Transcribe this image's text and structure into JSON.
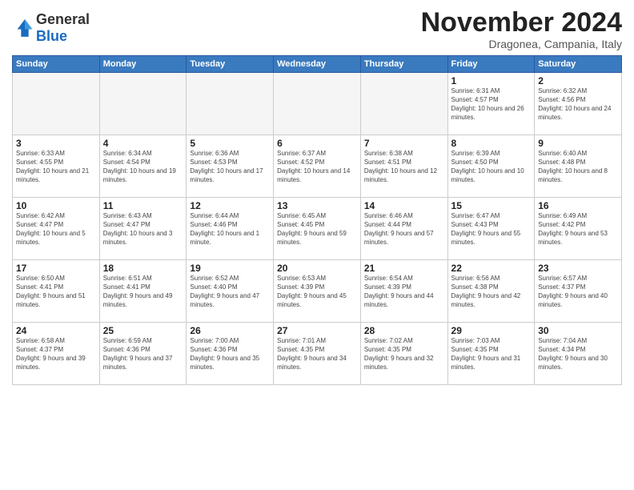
{
  "logo": {
    "text_general": "General",
    "text_blue": "Blue"
  },
  "title": "November 2024",
  "subtitle": "Dragonea, Campania, Italy",
  "days_header": [
    "Sunday",
    "Monday",
    "Tuesday",
    "Wednesday",
    "Thursday",
    "Friday",
    "Saturday"
  ],
  "weeks": [
    [
      {
        "day": "",
        "info": ""
      },
      {
        "day": "",
        "info": ""
      },
      {
        "day": "",
        "info": ""
      },
      {
        "day": "",
        "info": ""
      },
      {
        "day": "",
        "info": ""
      },
      {
        "day": "1",
        "info": "Sunrise: 6:31 AM\nSunset: 4:57 PM\nDaylight: 10 hours and 26 minutes."
      },
      {
        "day": "2",
        "info": "Sunrise: 6:32 AM\nSunset: 4:56 PM\nDaylight: 10 hours and 24 minutes."
      }
    ],
    [
      {
        "day": "3",
        "info": "Sunrise: 6:33 AM\nSunset: 4:55 PM\nDaylight: 10 hours and 21 minutes."
      },
      {
        "day": "4",
        "info": "Sunrise: 6:34 AM\nSunset: 4:54 PM\nDaylight: 10 hours and 19 minutes."
      },
      {
        "day": "5",
        "info": "Sunrise: 6:36 AM\nSunset: 4:53 PM\nDaylight: 10 hours and 17 minutes."
      },
      {
        "day": "6",
        "info": "Sunrise: 6:37 AM\nSunset: 4:52 PM\nDaylight: 10 hours and 14 minutes."
      },
      {
        "day": "7",
        "info": "Sunrise: 6:38 AM\nSunset: 4:51 PM\nDaylight: 10 hours and 12 minutes."
      },
      {
        "day": "8",
        "info": "Sunrise: 6:39 AM\nSunset: 4:50 PM\nDaylight: 10 hours and 10 minutes."
      },
      {
        "day": "9",
        "info": "Sunrise: 6:40 AM\nSunset: 4:48 PM\nDaylight: 10 hours and 8 minutes."
      }
    ],
    [
      {
        "day": "10",
        "info": "Sunrise: 6:42 AM\nSunset: 4:47 PM\nDaylight: 10 hours and 5 minutes."
      },
      {
        "day": "11",
        "info": "Sunrise: 6:43 AM\nSunset: 4:47 PM\nDaylight: 10 hours and 3 minutes."
      },
      {
        "day": "12",
        "info": "Sunrise: 6:44 AM\nSunset: 4:46 PM\nDaylight: 10 hours and 1 minute."
      },
      {
        "day": "13",
        "info": "Sunrise: 6:45 AM\nSunset: 4:45 PM\nDaylight: 9 hours and 59 minutes."
      },
      {
        "day": "14",
        "info": "Sunrise: 6:46 AM\nSunset: 4:44 PM\nDaylight: 9 hours and 57 minutes."
      },
      {
        "day": "15",
        "info": "Sunrise: 6:47 AM\nSunset: 4:43 PM\nDaylight: 9 hours and 55 minutes."
      },
      {
        "day": "16",
        "info": "Sunrise: 6:49 AM\nSunset: 4:42 PM\nDaylight: 9 hours and 53 minutes."
      }
    ],
    [
      {
        "day": "17",
        "info": "Sunrise: 6:50 AM\nSunset: 4:41 PM\nDaylight: 9 hours and 51 minutes."
      },
      {
        "day": "18",
        "info": "Sunrise: 6:51 AM\nSunset: 4:41 PM\nDaylight: 9 hours and 49 minutes."
      },
      {
        "day": "19",
        "info": "Sunrise: 6:52 AM\nSunset: 4:40 PM\nDaylight: 9 hours and 47 minutes."
      },
      {
        "day": "20",
        "info": "Sunrise: 6:53 AM\nSunset: 4:39 PM\nDaylight: 9 hours and 45 minutes."
      },
      {
        "day": "21",
        "info": "Sunrise: 6:54 AM\nSunset: 4:39 PM\nDaylight: 9 hours and 44 minutes."
      },
      {
        "day": "22",
        "info": "Sunrise: 6:56 AM\nSunset: 4:38 PM\nDaylight: 9 hours and 42 minutes."
      },
      {
        "day": "23",
        "info": "Sunrise: 6:57 AM\nSunset: 4:37 PM\nDaylight: 9 hours and 40 minutes."
      }
    ],
    [
      {
        "day": "24",
        "info": "Sunrise: 6:58 AM\nSunset: 4:37 PM\nDaylight: 9 hours and 39 minutes."
      },
      {
        "day": "25",
        "info": "Sunrise: 6:59 AM\nSunset: 4:36 PM\nDaylight: 9 hours and 37 minutes."
      },
      {
        "day": "26",
        "info": "Sunrise: 7:00 AM\nSunset: 4:36 PM\nDaylight: 9 hours and 35 minutes."
      },
      {
        "day": "27",
        "info": "Sunrise: 7:01 AM\nSunset: 4:35 PM\nDaylight: 9 hours and 34 minutes."
      },
      {
        "day": "28",
        "info": "Sunrise: 7:02 AM\nSunset: 4:35 PM\nDaylight: 9 hours and 32 minutes."
      },
      {
        "day": "29",
        "info": "Sunrise: 7:03 AM\nSunset: 4:35 PM\nDaylight: 9 hours and 31 minutes."
      },
      {
        "day": "30",
        "info": "Sunrise: 7:04 AM\nSunset: 4:34 PM\nDaylight: 9 hours and 30 minutes."
      }
    ]
  ]
}
